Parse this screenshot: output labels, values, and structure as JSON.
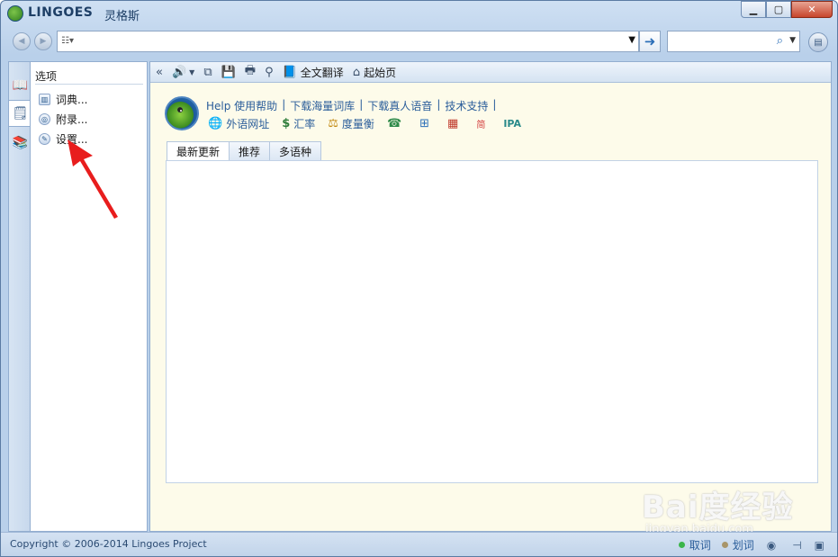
{
  "window": {
    "app_name": "LINGOES",
    "app_name_cn": "灵格斯",
    "minimize_icon": "minimize-icon",
    "maximize_icon": "maximize-icon",
    "close_icon": "close-icon"
  },
  "address_bar": {
    "back_icon": "back-icon",
    "forward_icon": "forward-icon",
    "query_value": "",
    "web_search_value": ""
  },
  "options_panel": {
    "title": "选项",
    "items": [
      {
        "label": "词典...",
        "icon": "dictionary-icon"
      },
      {
        "label": "附录...",
        "icon": "appendix-icon"
      },
      {
        "label": "设置...",
        "icon": "settings-icon"
      }
    ]
  },
  "toolbar": {
    "full_translate_label": "全文翻译",
    "home_label": "起始页"
  },
  "links": [
    "Help 使用帮助",
    "下载海量词库",
    "下载真人语音",
    "技术支持"
  ],
  "tools": {
    "foreign_sites": "外语网址",
    "exchange_rate": "汇率",
    "measures": "度量衡",
    "ipa": "IPA"
  },
  "tabs": [
    "最新更新",
    "推荐",
    "多语种"
  ],
  "statusbar": {
    "copyright": "Copyright © 2006-2014 Lingoes Project",
    "capture_word": "取词",
    "select_word": "划词"
  },
  "watermark": {
    "brand": "Bai度经验",
    "url": "jingyan.baidu.com"
  },
  "colors": {
    "accent": "#2a5d9a",
    "annotation_arrow": "#e81d1d",
    "panel_background": "#fdfbea"
  }
}
